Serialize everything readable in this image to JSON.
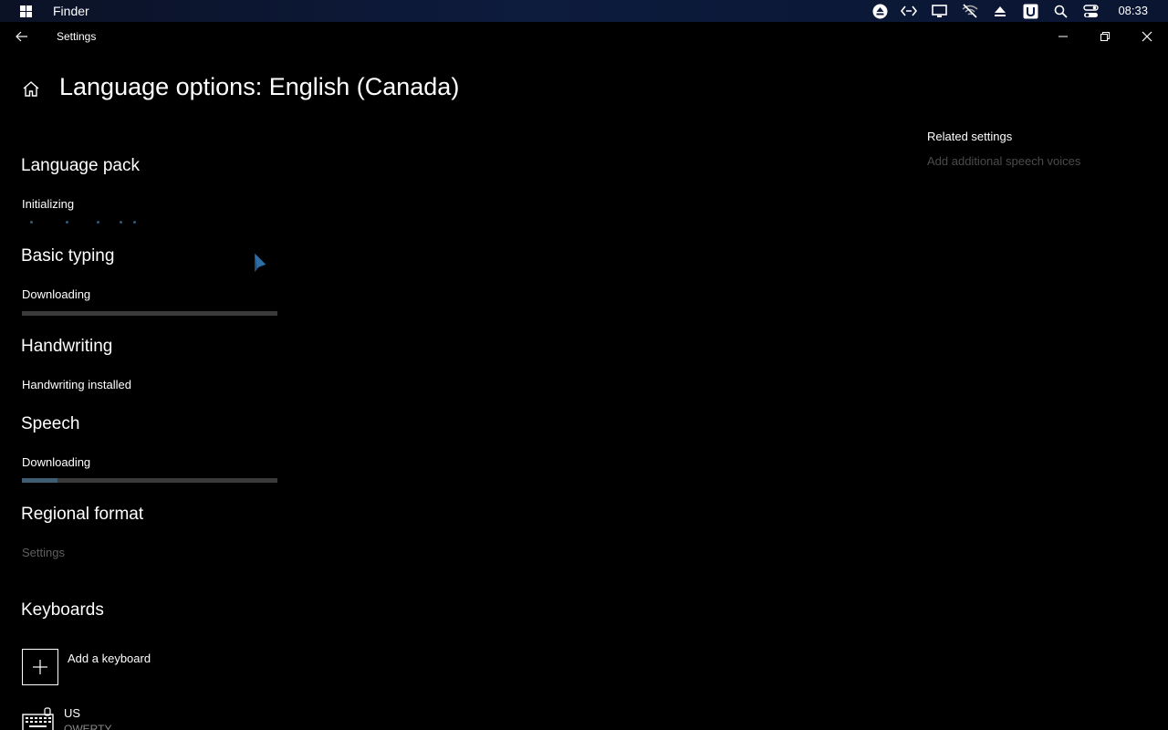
{
  "topbar": {
    "app_name": "Finder",
    "clock": "08:33",
    "tray_icons": [
      "eject-circle-icon",
      "code-arrows-icon",
      "monitor-icon",
      "wifi-off-icon",
      "eject-icon",
      "u-badge-icon",
      "search-icon",
      "toggles-icon"
    ]
  },
  "window": {
    "title": "Settings"
  },
  "page": {
    "title": "Language options: English (Canada)"
  },
  "sections": {
    "language_pack": {
      "heading": "Language pack",
      "status": "Initializing"
    },
    "basic_typing": {
      "heading": "Basic typing",
      "status": "Downloading",
      "progress": 0.0
    },
    "handwriting": {
      "heading": "Handwriting",
      "status": "Handwriting installed"
    },
    "speech": {
      "heading": "Speech",
      "status": "Downloading",
      "progress": 0.14
    },
    "regional_format": {
      "heading": "Regional format",
      "link": "Settings"
    },
    "keyboards": {
      "heading": "Keyboards",
      "add_label": "Add a keyboard",
      "items": [
        {
          "name": "US",
          "layout": "QWERTY"
        }
      ]
    }
  },
  "related": {
    "heading": "Related settings",
    "link": "Add additional speech voices"
  },
  "colors": {
    "accent": "#2d5b77",
    "muted_link": "#4b4b4b",
    "progress_track": "#3a3a3a"
  }
}
